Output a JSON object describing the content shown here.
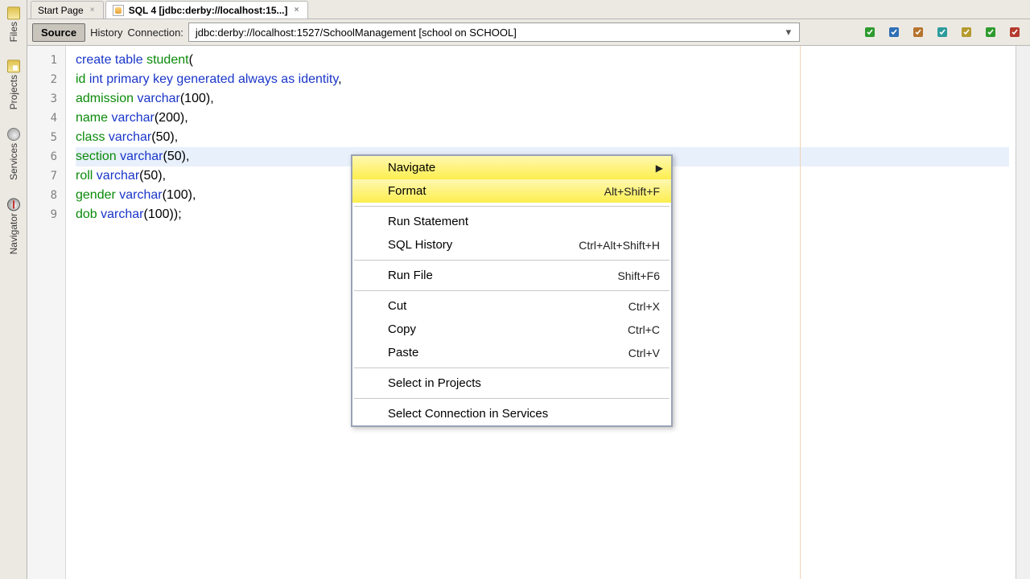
{
  "tabs": [
    {
      "label": "Start Page"
    },
    {
      "label": "SQL 4 [jdbc:derby://localhost:15...]"
    }
  ],
  "toolbar": {
    "source": "Source",
    "history": "History",
    "connection_label": "Connection:",
    "connection_value": "jdbc:derby://localhost:1527/SchoolManagement [school on SCHOOL]"
  },
  "sidebar": {
    "files": "Files",
    "projects": "Projects",
    "services": "Services",
    "navigator": "Navigator"
  },
  "code_lines": [
    [
      [
        "kw",
        "create"
      ],
      [
        "",
        " "
      ],
      [
        "kw",
        "table"
      ],
      [
        "",
        " "
      ],
      [
        "id",
        "student"
      ],
      [
        "",
        "("
      ]
    ],
    [
      [
        "id",
        "id"
      ],
      [
        "",
        " "
      ],
      [
        "kw",
        "int"
      ],
      [
        "",
        " "
      ],
      [
        "kw",
        "primary"
      ],
      [
        "",
        " "
      ],
      [
        "kw",
        "key"
      ],
      [
        "",
        " "
      ],
      [
        "kw",
        "generated"
      ],
      [
        "",
        " "
      ],
      [
        "kw",
        "always"
      ],
      [
        "",
        " "
      ],
      [
        "kw",
        "as"
      ],
      [
        "",
        " "
      ],
      [
        "kw",
        "identity"
      ],
      [
        "",
        ","
      ]
    ],
    [
      [
        "id",
        "admission"
      ],
      [
        "",
        " "
      ],
      [
        "kw",
        "varchar"
      ],
      [
        "",
        "(100),"
      ]
    ],
    [
      [
        "id",
        "name"
      ],
      [
        "",
        " "
      ],
      [
        "kw",
        "varchar"
      ],
      [
        "",
        "(200),"
      ]
    ],
    [
      [
        "id",
        "class"
      ],
      [
        "",
        " "
      ],
      [
        "kw",
        "varchar"
      ],
      [
        "",
        "(50),"
      ]
    ],
    [
      [
        "id",
        "section"
      ],
      [
        "",
        " "
      ],
      [
        "kw",
        "varchar"
      ],
      [
        "",
        "(50),"
      ]
    ],
    [
      [
        "id",
        "roll"
      ],
      [
        "",
        " "
      ],
      [
        "kw",
        "varchar"
      ],
      [
        "",
        "(50),"
      ]
    ],
    [
      [
        "id",
        "gender"
      ],
      [
        "",
        " "
      ],
      [
        "kw",
        "varchar"
      ],
      [
        "",
        "(100),"
      ]
    ],
    [
      [
        "id",
        "dob"
      ],
      [
        "",
        " "
      ],
      [
        "kw",
        "varchar"
      ],
      [
        "",
        "(100));"
      ]
    ]
  ],
  "highlighted_line_index": 5,
  "context_menu": {
    "items": [
      {
        "label": "Navigate",
        "submenu": true,
        "highlight": true
      },
      {
        "label": "Format",
        "shortcut": "Alt+Shift+F",
        "highlight": true
      },
      {
        "sep": true
      },
      {
        "label": "Run Statement"
      },
      {
        "label": "SQL History",
        "shortcut": "Ctrl+Alt+Shift+H"
      },
      {
        "sep": true
      },
      {
        "label": "Run File",
        "shortcut": "Shift+F6"
      },
      {
        "sep": true
      },
      {
        "label": "Cut",
        "shortcut": "Ctrl+X"
      },
      {
        "label": "Copy",
        "shortcut": "Ctrl+C"
      },
      {
        "label": "Paste",
        "shortcut": "Ctrl+V"
      },
      {
        "sep": true
      },
      {
        "label": "Select in Projects"
      },
      {
        "sep": true
      },
      {
        "label": "Select Connection in Services"
      }
    ]
  },
  "toolbar_icons": [
    "run-sql-icon",
    "run-script-icon",
    "sql-history-icon",
    "keep-tabs-icon",
    "export-icon",
    "refresh-icon",
    "close-icon"
  ],
  "icon_colors": {
    "run-sql-icon": "#2e9b2e",
    "run-script-icon": "#2e6fb5",
    "sql-history-icon": "#b5742e",
    "keep-tabs-icon": "#2e9b9b",
    "export-icon": "#b59a2e",
    "refresh-icon": "#2e9b2e",
    "close-icon": "#b53a2e"
  }
}
